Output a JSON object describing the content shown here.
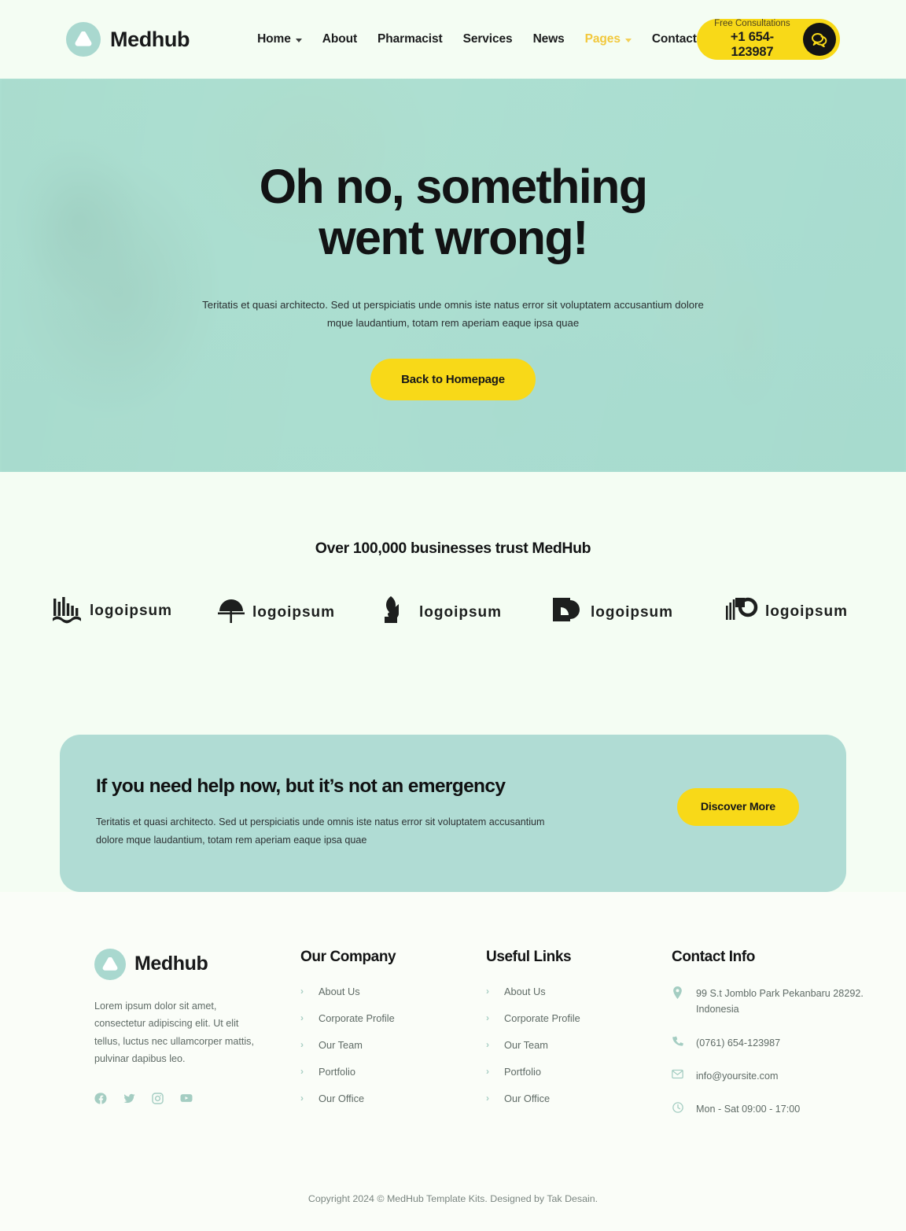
{
  "brand": {
    "name": "Medhub",
    "mark_icon": "triangle-logo-icon",
    "mark_color": "#a9d8cf"
  },
  "header": {
    "nav": [
      {
        "label": "Home",
        "has_dropdown": true,
        "active": false
      },
      {
        "label": "About",
        "has_dropdown": false,
        "active": false
      },
      {
        "label": "Pharmacist",
        "has_dropdown": false,
        "active": false
      },
      {
        "label": "Services",
        "has_dropdown": false,
        "active": false
      },
      {
        "label": "News",
        "has_dropdown": false,
        "active": false
      },
      {
        "label": "Pages",
        "has_dropdown": true,
        "active": true
      },
      {
        "label": "Contact",
        "has_dropdown": false,
        "active": false
      }
    ],
    "cta": {
      "label": "Free Consultations",
      "phone": "+1 654-123987",
      "icon": "chat-bubbles-icon",
      "bg_color": "#f8d918"
    }
  },
  "hero": {
    "title_line1": "Oh no, something",
    "title_line2": "went wrong!",
    "subtitle": "Teritatis et quasi architecto. Sed ut perspiciatis unde omnis iste natus error sit voluptatem accusantium dolore mque laudantium, totam rem aperiam eaque ipsa quae",
    "button_label": "Back to Homepage",
    "overlay_color": "#9ddbcc"
  },
  "trust": {
    "title": "Over 100,000 businesses trust MedHub",
    "logos": [
      {
        "name": "logoipsum-bars-wave",
        "text": "logoipsum"
      },
      {
        "name": "logoipsum-arch",
        "text": "logoipsum"
      },
      {
        "name": "logoipsum-leaf",
        "text": "logoipsum"
      },
      {
        "name": "logoipsum-square",
        "text": "logoipsum"
      },
      {
        "name": "logoipsum-circle-bars",
        "text": "logoipsum"
      }
    ]
  },
  "cta_band": {
    "heading": "If you need help now, but it’s not an emergency",
    "description": "Teritatis et quasi architecto. Sed ut perspiciatis unde omnis iste natus error sit voluptatem accusantium dolore mque laudantium, totam rem aperiam eaque ipsa quae",
    "button_label": "Discover More",
    "bg_color": "#b0dcd4",
    "button_color": "#f8d918"
  },
  "footer": {
    "about": "Lorem ipsum dolor sit amet, consectetur adipiscing elit. Ut elit tellus, luctus nec ullamcorper mattis, pulvinar dapibus leo.",
    "socials": [
      {
        "name": "facebook-icon"
      },
      {
        "name": "twitter-icon"
      },
      {
        "name": "instagram-icon"
      },
      {
        "name": "youtube-icon"
      }
    ],
    "company": {
      "title": "Our Company",
      "links": [
        "About Us",
        "Corporate Profile",
        "Our Team",
        "Portfolio",
        "Our Office"
      ]
    },
    "useful": {
      "title": "Useful Links",
      "links": [
        "About Us",
        "Corporate Profile",
        "Our Team",
        "Portfolio",
        "Our Office"
      ]
    },
    "contact": {
      "title": "Contact Info",
      "items": [
        {
          "icon": "location-pin-icon",
          "text": "99 S.t Jomblo Park Pekanbaru 28292. Indonesia"
        },
        {
          "icon": "phone-icon",
          "text": "(0761) 654-123987"
        },
        {
          "icon": "mail-icon",
          "text": "info@yoursite.com"
        },
        {
          "icon": "clock-icon",
          "text": "Mon - Sat 09:00 - 17:00"
        }
      ]
    },
    "copyright": "Copyright 2024 © MedHub Template Kits. Designed by Tak Desain."
  }
}
